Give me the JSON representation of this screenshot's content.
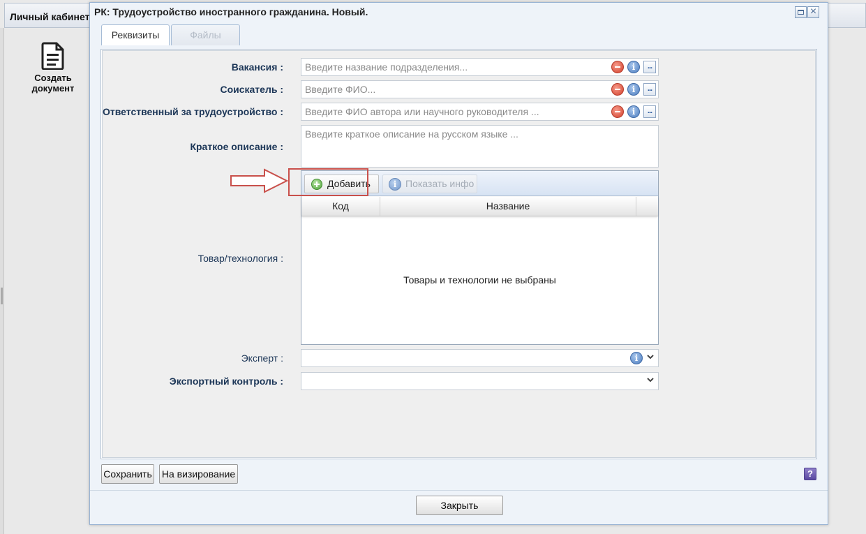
{
  "background": {
    "header_title": "Личный кабинет",
    "create_doc_label": "Создать документ"
  },
  "dialog": {
    "title": "РК: Трудоустройство иностранного гражданина. Новый.",
    "tabs": [
      {
        "label": "Реквизиты",
        "active": true
      },
      {
        "label": "Файлы",
        "active": false
      }
    ]
  },
  "form": {
    "vacancy": {
      "label": "Вакансия :",
      "placeholder": "Введите название подразделения...",
      "value": ""
    },
    "applicant": {
      "label": "Соискатель :",
      "placeholder": "Введите ФИО...",
      "value": ""
    },
    "responsible": {
      "label": "Ответственный за трудоустройство :",
      "placeholder": "Введите ФИО автора или научного руководителя ...",
      "value": ""
    },
    "description": {
      "label": "Краткое описание :",
      "placeholder": "Введите краткое описание на русском языке ...",
      "value": ""
    },
    "goods": {
      "label": "Товар/технология :",
      "add_label": "Добавить",
      "info_label": "Показать инфо",
      "columns": [
        "Код",
        "Название"
      ],
      "empty_text": "Товары и технологии не выбраны"
    },
    "expert": {
      "label": "Эксперт :",
      "value": ""
    },
    "export_control": {
      "label": "Экспортный контроль :",
      "value": ""
    }
  },
  "footer": {
    "save_label": "Сохранить",
    "approve_label": "На визирование",
    "help_label": "?",
    "close_label": "Закрыть"
  },
  "colors": {
    "label_text": "#1c3657",
    "highlight": "#c9504b",
    "dialog_border": "#98b3d3"
  }
}
